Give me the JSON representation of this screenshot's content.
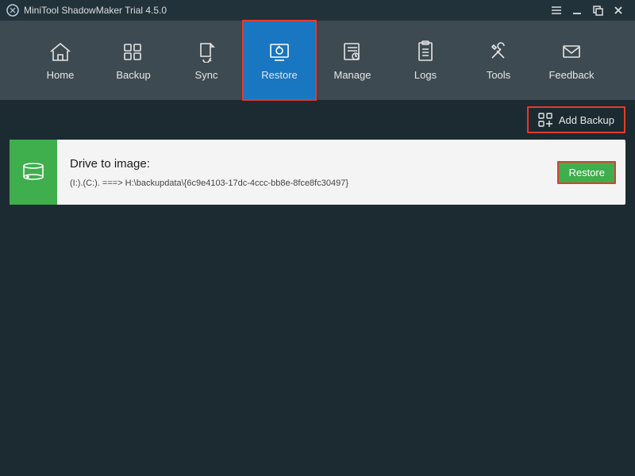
{
  "titlebar": {
    "title": "MiniTool ShadowMaker Trial 4.5.0"
  },
  "nav": {
    "items": [
      {
        "label": "Home"
      },
      {
        "label": "Backup"
      },
      {
        "label": "Sync"
      },
      {
        "label": "Restore"
      },
      {
        "label": "Manage"
      },
      {
        "label": "Logs"
      },
      {
        "label": "Tools"
      },
      {
        "label": "Feedback"
      }
    ]
  },
  "toolbar": {
    "add_backup_label": "Add Backup"
  },
  "card": {
    "title": "Drive to image:",
    "path": "(I:).(C:). ===> H:\\backupdata\\{6c9e4103-17dc-4ccc-bb8e-8fce8fc30497}",
    "restore_label": "Restore"
  }
}
